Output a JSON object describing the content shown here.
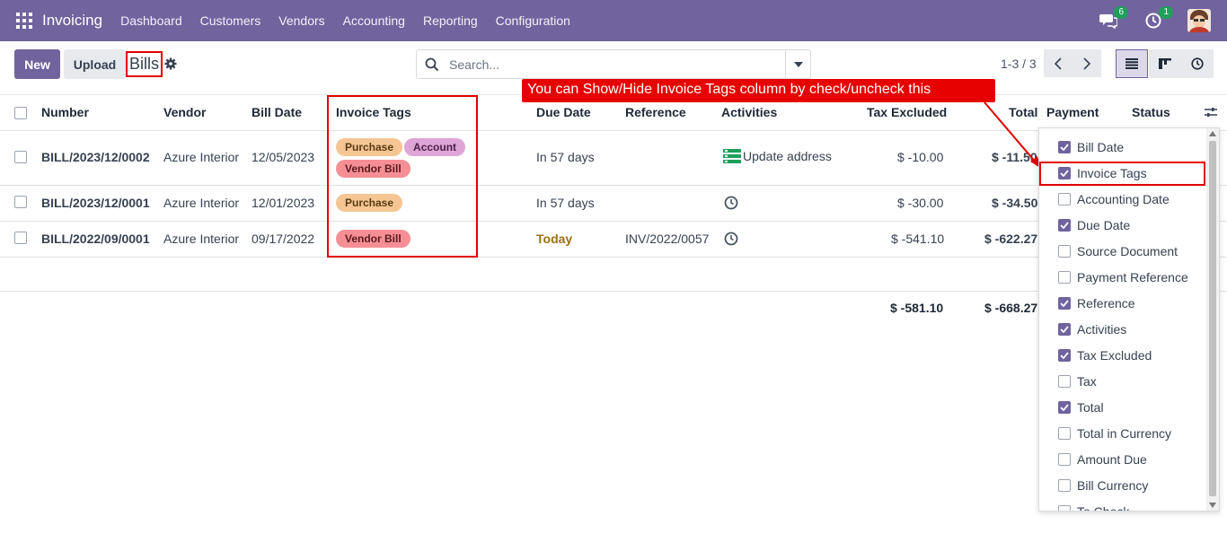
{
  "navbar": {
    "app_name": "Invoicing",
    "menu": [
      "Dashboard",
      "Customers",
      "Vendors",
      "Accounting",
      "Reporting",
      "Configuration"
    ],
    "messages_count": "6",
    "activities_count": "1",
    "bg_color": "#71639e"
  },
  "control": {
    "new_label": "New",
    "upload_label": "Upload",
    "title": "Bills",
    "search_placeholder": "Search...",
    "pager": "1-3 / 3"
  },
  "table": {
    "headers": {
      "number": "Number",
      "vendor": "Vendor",
      "bill_date": "Bill Date",
      "invoice_tags": "Invoice Tags",
      "due_date": "Due Date",
      "reference": "Reference",
      "activities": "Activities",
      "tax_excluded": "Tax Excluded",
      "total": "Total",
      "payment": "Payment",
      "status": "Status"
    },
    "rows": [
      {
        "number": "BILL/2023/12/0002",
        "vendor": "Azure Interior",
        "bill_date": "12/05/2023",
        "tags": [
          "Purchase",
          "Account",
          "Vendor Bill"
        ],
        "due_date": "In 57 days",
        "reference": "",
        "activity": "Update address",
        "tax_excluded": "$ -10.00",
        "total": "$ -11.50"
      },
      {
        "number": "BILL/2023/12/0001",
        "vendor": "Azure Interior",
        "bill_date": "12/01/2023",
        "tags": [
          "Purchase"
        ],
        "due_date": "In 57 days",
        "reference": "",
        "activity": "",
        "tax_excluded": "$ -30.00",
        "total": "$ -34.50"
      },
      {
        "number": "BILL/2022/09/0001",
        "vendor": "Azure Interior",
        "bill_date": "09/17/2022",
        "tags": [
          "Vendor Bill"
        ],
        "due_date": "Today",
        "reference": "INV/2022/0057",
        "activity": "",
        "tax_excluded": "$ -541.10",
        "total": "$ -622.27"
      }
    ],
    "totals": {
      "tax_excluded": "$ -581.10",
      "total": "$ -668.27"
    }
  },
  "callout": {
    "text": "You can Show/Hide Invoice Tags column by check/uncheck this"
  },
  "optional_columns": [
    {
      "label": "Bill Date",
      "checked": true
    },
    {
      "label": "Invoice Tags",
      "checked": true
    },
    {
      "label": "Accounting Date",
      "checked": false
    },
    {
      "label": "Due Date",
      "checked": true
    },
    {
      "label": "Source Document",
      "checked": false
    },
    {
      "label": "Payment Reference",
      "checked": false
    },
    {
      "label": "Reference",
      "checked": true
    },
    {
      "label": "Activities",
      "checked": true
    },
    {
      "label": "Tax Excluded",
      "checked": true
    },
    {
      "label": "Tax",
      "checked": false
    },
    {
      "label": "Total",
      "checked": true
    },
    {
      "label": "Total in Currency",
      "checked": false
    },
    {
      "label": "Amount Due",
      "checked": false
    },
    {
      "label": "Bill Currency",
      "checked": false
    },
    {
      "label": "To Check",
      "checked": false
    }
  ]
}
